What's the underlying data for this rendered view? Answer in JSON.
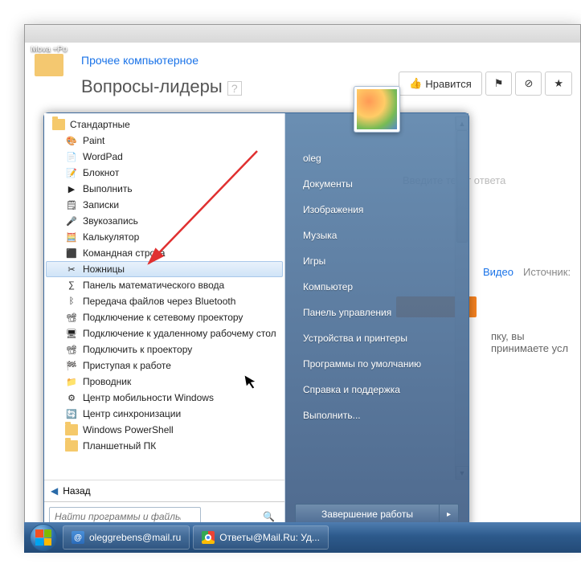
{
  "desktop_icon_label": "Mova +Po",
  "browser": {
    "breadcrumb": "Прочее компьютерное",
    "heading": "Вопросы-лидеры",
    "like_btn": "Нравится",
    "answer_placeholder": "Введите текст ответа",
    "video_link": "Видео",
    "source_label": "Источник:",
    "terms_note": "пку, вы принимаете усл"
  },
  "start_menu": {
    "folder_header": "Стандартные",
    "programs": [
      {
        "label": "Paint",
        "icon": "🎨"
      },
      {
        "label": "WordPad",
        "icon": "📄"
      },
      {
        "label": "Блокнот",
        "icon": "📝"
      },
      {
        "label": "Выполнить",
        "icon": "▶"
      },
      {
        "label": "Записки",
        "icon": "🗒"
      },
      {
        "label": "Звукозапись",
        "icon": "🎤"
      },
      {
        "label": "Калькулятор",
        "icon": "🧮"
      },
      {
        "label": "Командная строка",
        "icon": "⬛"
      },
      {
        "label": "Ножницы",
        "icon": "✂",
        "selected": true
      },
      {
        "label": "Панель математического ввода",
        "icon": "∑"
      },
      {
        "label": "Передача файлов через Bluetooth",
        "icon": "ᛒ"
      },
      {
        "label": "Подключение к сетевому проектору",
        "icon": "📽"
      },
      {
        "label": "Подключение к удаленному рабочему стол",
        "icon": "🖥"
      },
      {
        "label": "Подключить к проектору",
        "icon": "📽"
      },
      {
        "label": "Приступая к работе",
        "icon": "🏁"
      },
      {
        "label": "Проводник",
        "icon": "📁"
      },
      {
        "label": "Центр мобильности Windows",
        "icon": "⚙"
      },
      {
        "label": "Центр синхронизации",
        "icon": "🔄"
      },
      {
        "label": "Windows PowerShell",
        "icon": "📁",
        "folder": true
      },
      {
        "label": "Планшетный ПК",
        "icon": "📁",
        "folder": true
      }
    ],
    "back_label": "Назад",
    "search_placeholder": "Найти программы и файлы",
    "right_items": [
      "oleg",
      "Документы",
      "Изображения",
      "Музыка",
      "Игры",
      "Компьютер",
      "Панель управления",
      "Устройства и принтеры",
      "Программы по умолчанию",
      "Справка и поддержка",
      "Выполнить..."
    ],
    "shutdown_label": "Завершение работы"
  },
  "taskbar": {
    "items": [
      {
        "label": "oleggrebens@mail.ru",
        "icon": "mail"
      },
      {
        "label": "Ответы@Mail.Ru: Уд...",
        "icon": "chrome"
      }
    ]
  }
}
